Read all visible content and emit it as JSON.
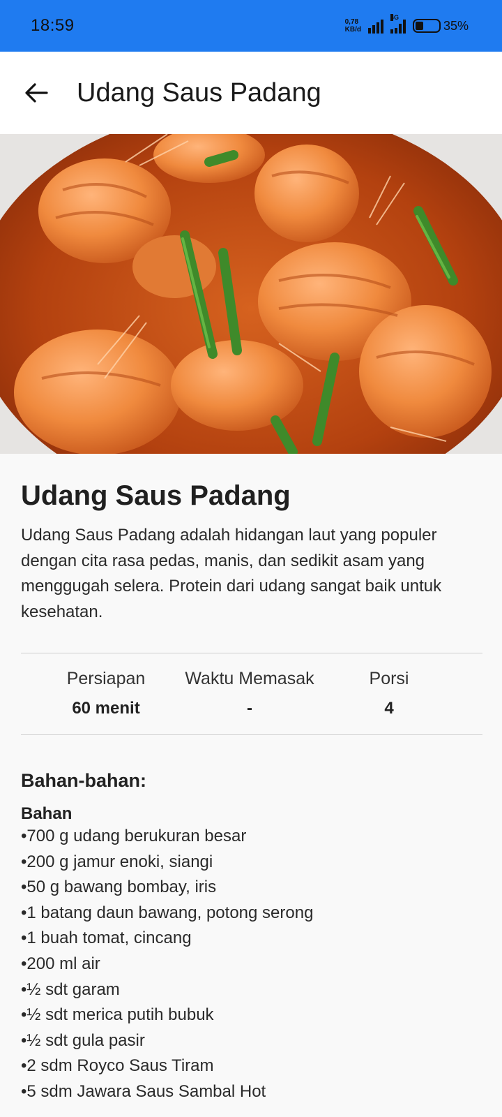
{
  "status_bar": {
    "time": "18:59",
    "net_speed_value": "0,78",
    "net_speed_unit": "KB/d",
    "network_type": "4G",
    "battery_percent": "35%",
    "battery_level": 0.35
  },
  "app_bar": {
    "title": "Udang Saus Padang",
    "back_icon": "arrow-left-icon"
  },
  "recipe": {
    "title": "Udang Saus Padang",
    "description": "Udang Saus Padang adalah hidangan laut yang populer dengan cita rasa pedas, manis, dan sedikit asam yang menggugah selera. Protein dari udang sangat baik untuk kesehatan.",
    "stats": [
      {
        "label": "Persiapan",
        "value": "60 menit"
      },
      {
        "label": "Waktu Memasak",
        "value": "-"
      },
      {
        "label": "Porsi",
        "value": "4"
      }
    ],
    "ingredients_heading": "Bahan-bahan:",
    "ingredients_group": "Bahan",
    "ingredients": [
      "•700 g udang berukuran besar",
      "•200 g jamur enoki, siangi",
      "•50 g bawang bombay, iris",
      "•1 batang daun bawang, potong serong",
      "•1 buah tomat, cincang",
      "•200 ml air",
      "•½ sdt garam",
      "•½ sdt merica putih bubuk",
      "•½ sdt gula pasir",
      "•2 sdm Royco Saus Tiram",
      "•5 sdm Jawara Saus Sambal Hot"
    ]
  },
  "colors": {
    "status_bar_bg": "#1f7bf0",
    "app_bar_bg": "#ffffff",
    "page_bg": "#f9f9f9"
  }
}
